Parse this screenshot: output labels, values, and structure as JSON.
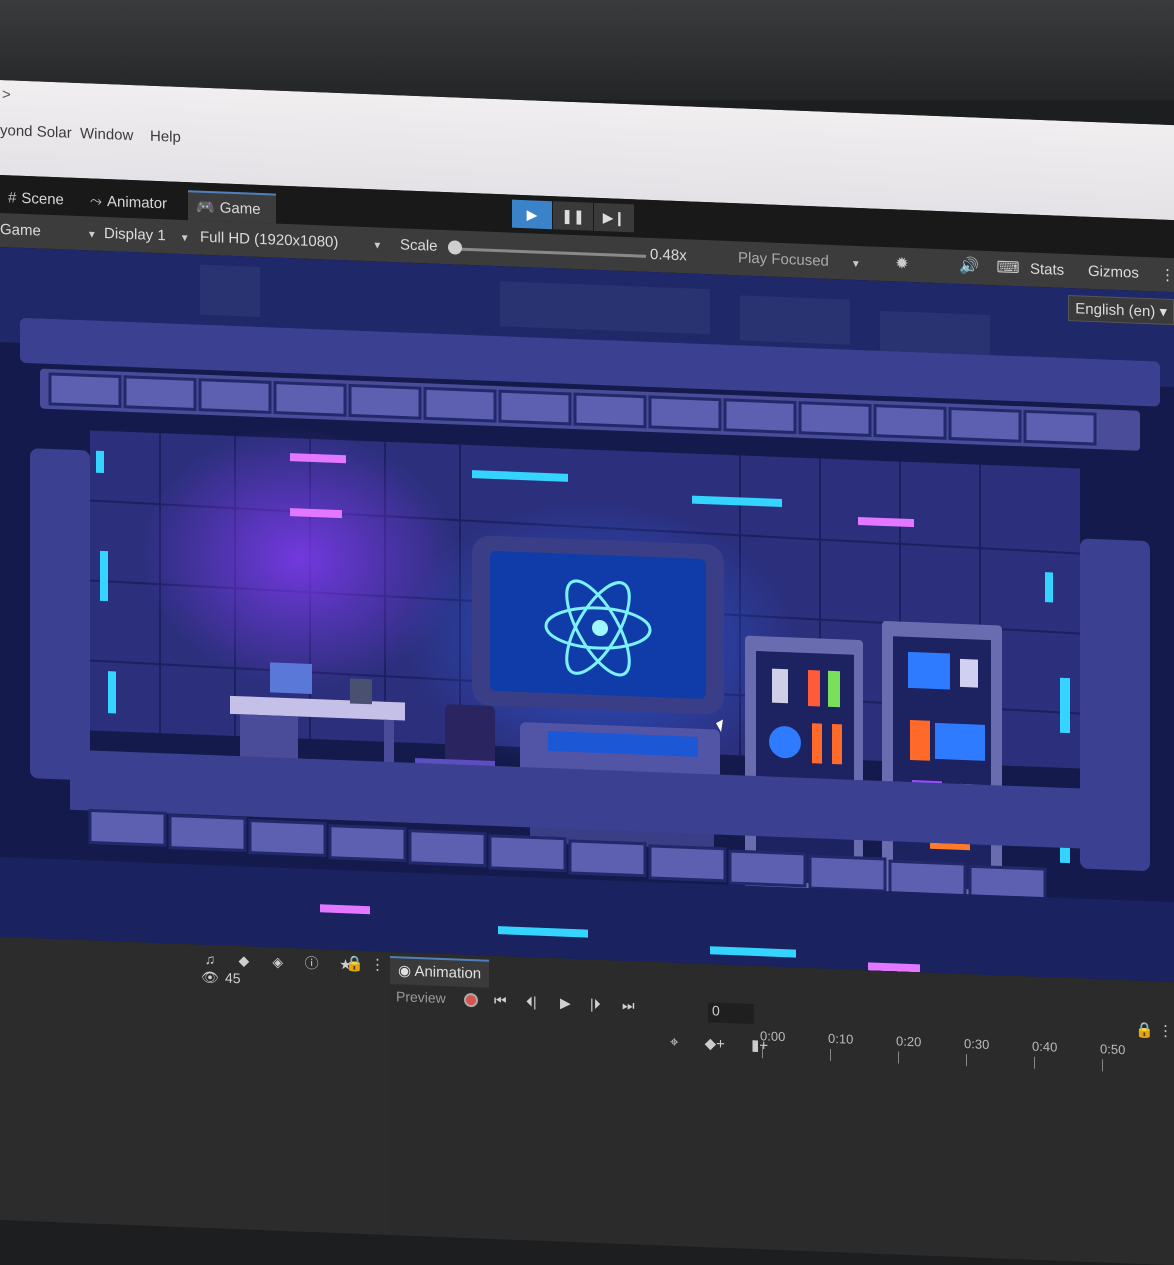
{
  "menu": {
    "chevron": ">",
    "items": [
      "yond Solar",
      "Window",
      "Help"
    ]
  },
  "playbar": {
    "play": "▶",
    "pause": "❚❚",
    "step": "▶❙"
  },
  "tabs": [
    {
      "icon": "#",
      "label": "Scene"
    },
    {
      "icon": "⤳",
      "label": "Animator"
    },
    {
      "icon": "🎮",
      "label": "Game"
    }
  ],
  "game_toolbar": {
    "mode": "Game",
    "display": "Display 1",
    "resolution": "Full HD (1920x1080)",
    "scale_label": "Scale",
    "scale_value": "0.48x",
    "play_mode": "Play Focused",
    "stats": "Stats",
    "gizmos": "Gizmos",
    "more": "⋮"
  },
  "language": "English (en) ▾",
  "bottom_left": {
    "lock": "🔒",
    "menu": "⋮",
    "visible_count": "45",
    "eye": "👁"
  },
  "animation": {
    "tab_label": "Animation",
    "preview": "Preview",
    "frame_value": "0",
    "timeline_ticks": [
      "0:00",
      "0:10",
      "0:20",
      "0:30",
      "0:40",
      "0:50"
    ],
    "lock": "🔒",
    "menu": "⋮"
  },
  "colors": {
    "accent": "#3b83c9",
    "scene_bg": "#121a4a",
    "neon_cyan": "#35d4ff",
    "neon_pink": "#e477ff"
  }
}
